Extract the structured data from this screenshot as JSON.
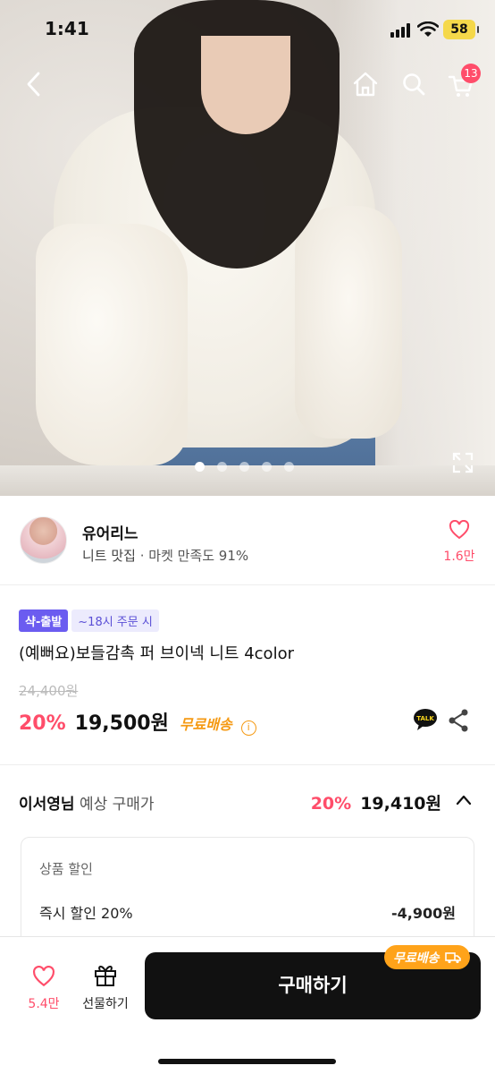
{
  "status_bar": {
    "time": "1:41",
    "battery": "58"
  },
  "header": {
    "cart_count": "13"
  },
  "gallery": {
    "slides": 5,
    "active_slide": 1
  },
  "store": {
    "name": "유어리느",
    "category": "니트 맛집",
    "satisfaction": " · 마켓 만족도 91%",
    "like_count": "1.6만"
  },
  "product": {
    "badge": "샥-출발",
    "badge_sub": "~18시 주문 시",
    "title": "(예뻐요)보들감촉 퍼 브이넥 니트 4color",
    "original_price": "24,400원",
    "discount": "20%",
    "price": "19,500원",
    "shipping": "무료배송",
    "talk_label": "TALK"
  },
  "member": {
    "name": "이서영님",
    "label": " 예상 구매가",
    "discount": "20%",
    "price": "19,410원"
  },
  "discount_details": {
    "title": "상품 할인",
    "row_label": "즉시 할인 20%",
    "row_value": "-4,900원"
  },
  "bottom_bar": {
    "like_count": "5.4만",
    "gift_label": "선물하기",
    "buy_label": "구매하기",
    "shipping_tag": "무료배송"
  },
  "colors": {
    "accent_pink": "#ff4d6a",
    "badge_purple": "#6b5cf0",
    "shipping_orange": "#f59a14"
  }
}
